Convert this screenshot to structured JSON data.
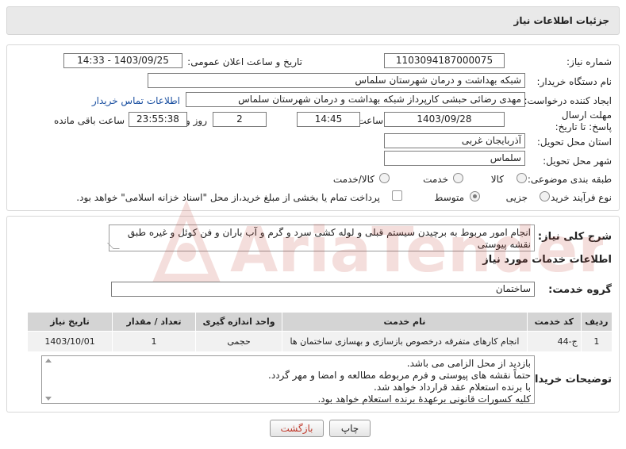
{
  "header": {
    "title": "جزئیات اطلاعات نیاز"
  },
  "form": {
    "need_number_label": "شماره نیاز:",
    "need_number": "1103094187000075",
    "announce_datetime_label": "تاریخ و ساعت اعلان عمومی:",
    "announce_datetime": "1403/09/25 - 14:33",
    "buyer_org_label": "نام دستگاه خریدار:",
    "buyer_org": "شبکه بهداشت و درمان  شهرستان سلماس",
    "requester_label": "ایجاد کننده درخواست:",
    "requester": "مهدی رضائی حبشی کارپرداز شبکه بهداشت و درمان  شهرستان سلماس",
    "contact_link": "اطلاعات تماس خریدار",
    "deadline_label": "مهلت ارسال پاسخ: تا تاریخ:",
    "deadline_date": "1403/09/28",
    "time_label": "ساعت",
    "deadline_time": "14:45",
    "days_value": "2",
    "days_label": "روز و",
    "remaining_time": "23:55:38",
    "remaining_label": "ساعت باقی مانده",
    "province_label": "استان محل تحویل:",
    "province": "آذربایجان غربی",
    "city_label": "شهر محل تحویل:",
    "city": "سلماس",
    "category_label": "طبقه بندی موضوعی:",
    "category_options": [
      "کالا",
      "خدمت",
      "کالا/خدمت"
    ],
    "process_label": "نوع فرآیند خرید :",
    "process_options": [
      "جزیی",
      "متوسط"
    ],
    "payment_note": "پرداخت تمام یا بخشی از مبلغ خرید،از محل \"اسناد خزانه اسلامی\" خواهد بود."
  },
  "summary": {
    "label": "شرح کلی نیاز:",
    "text": "انجام امور مربوط به برچیدن سیستم قبلی و لوله کشی سرد و گرم و آب باران و فن کوئل و غیره طبق نقشه پیوستی"
  },
  "services": {
    "section_title": "اطلاعات خدمات مورد نیاز",
    "group_label": "گروه خدمت:",
    "group_value": "ساختمان",
    "columns": [
      "ردیف",
      "کد خدمت",
      "نام خدمت",
      "واحد اندازه گیری",
      "تعداد / مقدار",
      "تاریخ نیاز"
    ],
    "rows": [
      [
        "1",
        "ج-44",
        "انجام کارهای متفرقه درخصوص بازسازی و بهسازی ساختمان ها",
        "حجمی",
        "1",
        "1403/10/01"
      ]
    ]
  },
  "buyer_notes": {
    "label": "توضیحات خریدار:",
    "lines": [
      "بازدید از محل الزامی می باشد.",
      "حتماً نقشه های پیوستی و فرم مربوطه مطالعه و امضا و مهر گردد.",
      "با برنده استعلام عقد قرارداد خواهد شد.",
      "کلیه کسورات قانونی برعهدهٔ برنده استعلام خواهد بود."
    ]
  },
  "buttons": {
    "print": "چاپ",
    "back": "بازگشت"
  },
  "watermark": {
    "text": "AriaTender.net"
  },
  "colors": {
    "back_button_text": "#c0392b",
    "link": "#1a4fa0",
    "watermark": "#c0392b"
  }
}
